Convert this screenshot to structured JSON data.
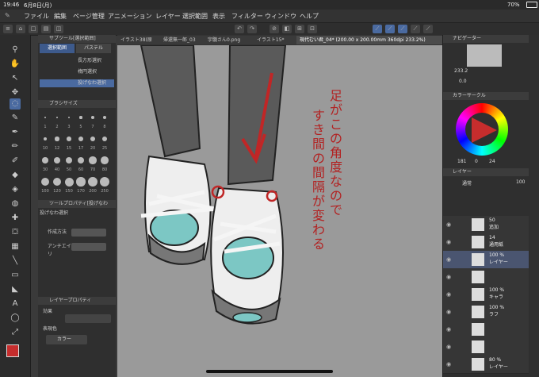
{
  "status": {
    "time": "19:46",
    "date": "6月8日(月)",
    "battery": "70%"
  },
  "menu": [
    "ファイル",
    "編集",
    "ページ管理",
    "アニメーション",
    "レイヤー",
    "選択範囲",
    "表示",
    "フィルター",
    "ウィンドウ",
    "ヘルプ"
  ],
  "tabs": [
    "イラスト38(原",
    "帰還無一郎_03",
    "宇髄さん0.png",
    "イラスト15*",
    "現代むい君_04* (200.00 x 200.00mm 360dpi 233.2%)"
  ],
  "subtool": {
    "header": "サブツール[選択範囲]",
    "tabs": [
      "選択範囲",
      "パステル"
    ],
    "items": [
      "長方形選択",
      "楕円選択",
      "投げなわ選択"
    ]
  },
  "brush_size_header": "ブラシサイズ",
  "brush_sizes": [
    "1",
    "2",
    "3",
    "5",
    "7",
    "8",
    "10",
    "12",
    "15",
    "17",
    "20",
    "25",
    "30",
    "40",
    "50",
    "60",
    "70",
    "80",
    "100",
    "120",
    "150",
    "170",
    "200",
    "250"
  ],
  "tool_property": {
    "header": "ツールプロパティ[投げなわ",
    "subheader": "投げなわ選択",
    "label1": "作成方法",
    "label2": "アンチエイリ"
  },
  "layer_property": {
    "header": "レイヤープロパティ",
    "effect": "効果",
    "expression_color": "表現色",
    "color_option": "カラー"
  },
  "navigator": {
    "header": "ナビゲーター",
    "zoom": "233.2",
    "angle": "0.0"
  },
  "color_circle": {
    "header": "カラーサークル",
    "values": [
      "181",
      "0",
      "24"
    ]
  },
  "layer_panel": {
    "header": "レイヤー",
    "blend": "通常",
    "opacity": "100"
  },
  "layers": [
    {
      "name1": "50",
      "name2": "追加"
    },
    {
      "name1": "14",
      "name2": "通用紙"
    },
    {
      "name1": "100 %",
      "name2": "レイヤー"
    },
    {
      "name1": "",
      "name2": ""
    },
    {
      "name1": "100 %",
      "name2": "キャラ"
    },
    {
      "name1": "100 %",
      "name2": "ラフ"
    },
    {
      "name1": "",
      "name2": ""
    },
    {
      "name1": "",
      "name2": ""
    },
    {
      "name1": "80 %",
      "name2": "レイヤー"
    }
  ],
  "annotation_text_col1": "足がこの角度なので",
  "annotation_text_col2": "すき間の間隔が変わる"
}
